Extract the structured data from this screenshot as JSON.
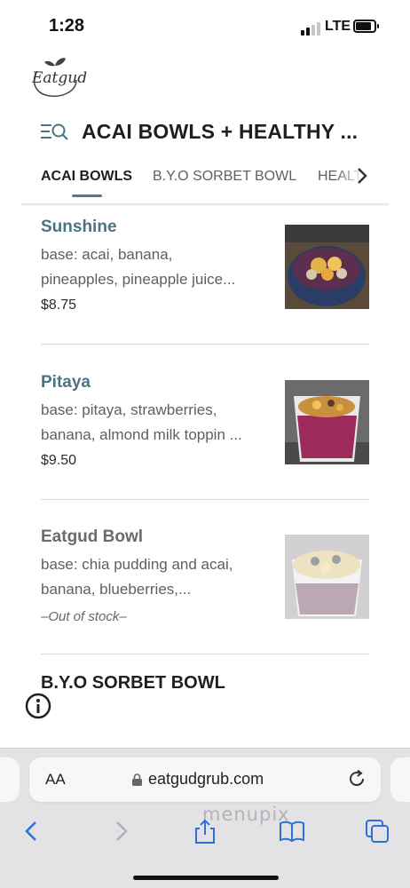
{
  "status_bar": {
    "time": "1:28",
    "network": "LTE"
  },
  "brand": {
    "logo_text": "Eatgud"
  },
  "header": {
    "title": "ACAI BOWLS + HEALTHY ..."
  },
  "tabs": [
    {
      "label": "ACAI BOWLS",
      "active": true
    },
    {
      "label": "B.Y.O SORBET BOWL",
      "active": false
    },
    {
      "label": "HEALTHY",
      "active": false
    }
  ],
  "items": [
    {
      "name": "Sunshine",
      "desc_line1": "base: acai, banana,",
      "desc_line2": "pineapples, pineapple juice...",
      "price": "$8.75"
    },
    {
      "name": "Pitaya",
      "desc_line1": "base: pitaya, strawberries,",
      "desc_line2": "banana, almond milk toppin ...",
      "price": "$9.50"
    },
    {
      "name": "Eatgud Bowl",
      "desc_line1": "base: chia pudding and acai,",
      "desc_line2": "banana, blueberries,...",
      "stock": "–Out of stock–"
    }
  ],
  "next_section": {
    "title": "B.Y.O SORBET BOWL"
  },
  "browser": {
    "text_size_label": "AA",
    "url": "eatgudgrub.com",
    "watermark": "menupix"
  },
  "icons": [
    "search-menu-icon",
    "chevron-right-icon",
    "info-icon",
    "lock-icon",
    "reload-icon",
    "back-icon",
    "forward-icon",
    "share-icon",
    "bookmarks-icon",
    "tabs-icon"
  ],
  "colors": {
    "accent": "#4b7482",
    "tab_indicator": "#4c7a86"
  }
}
